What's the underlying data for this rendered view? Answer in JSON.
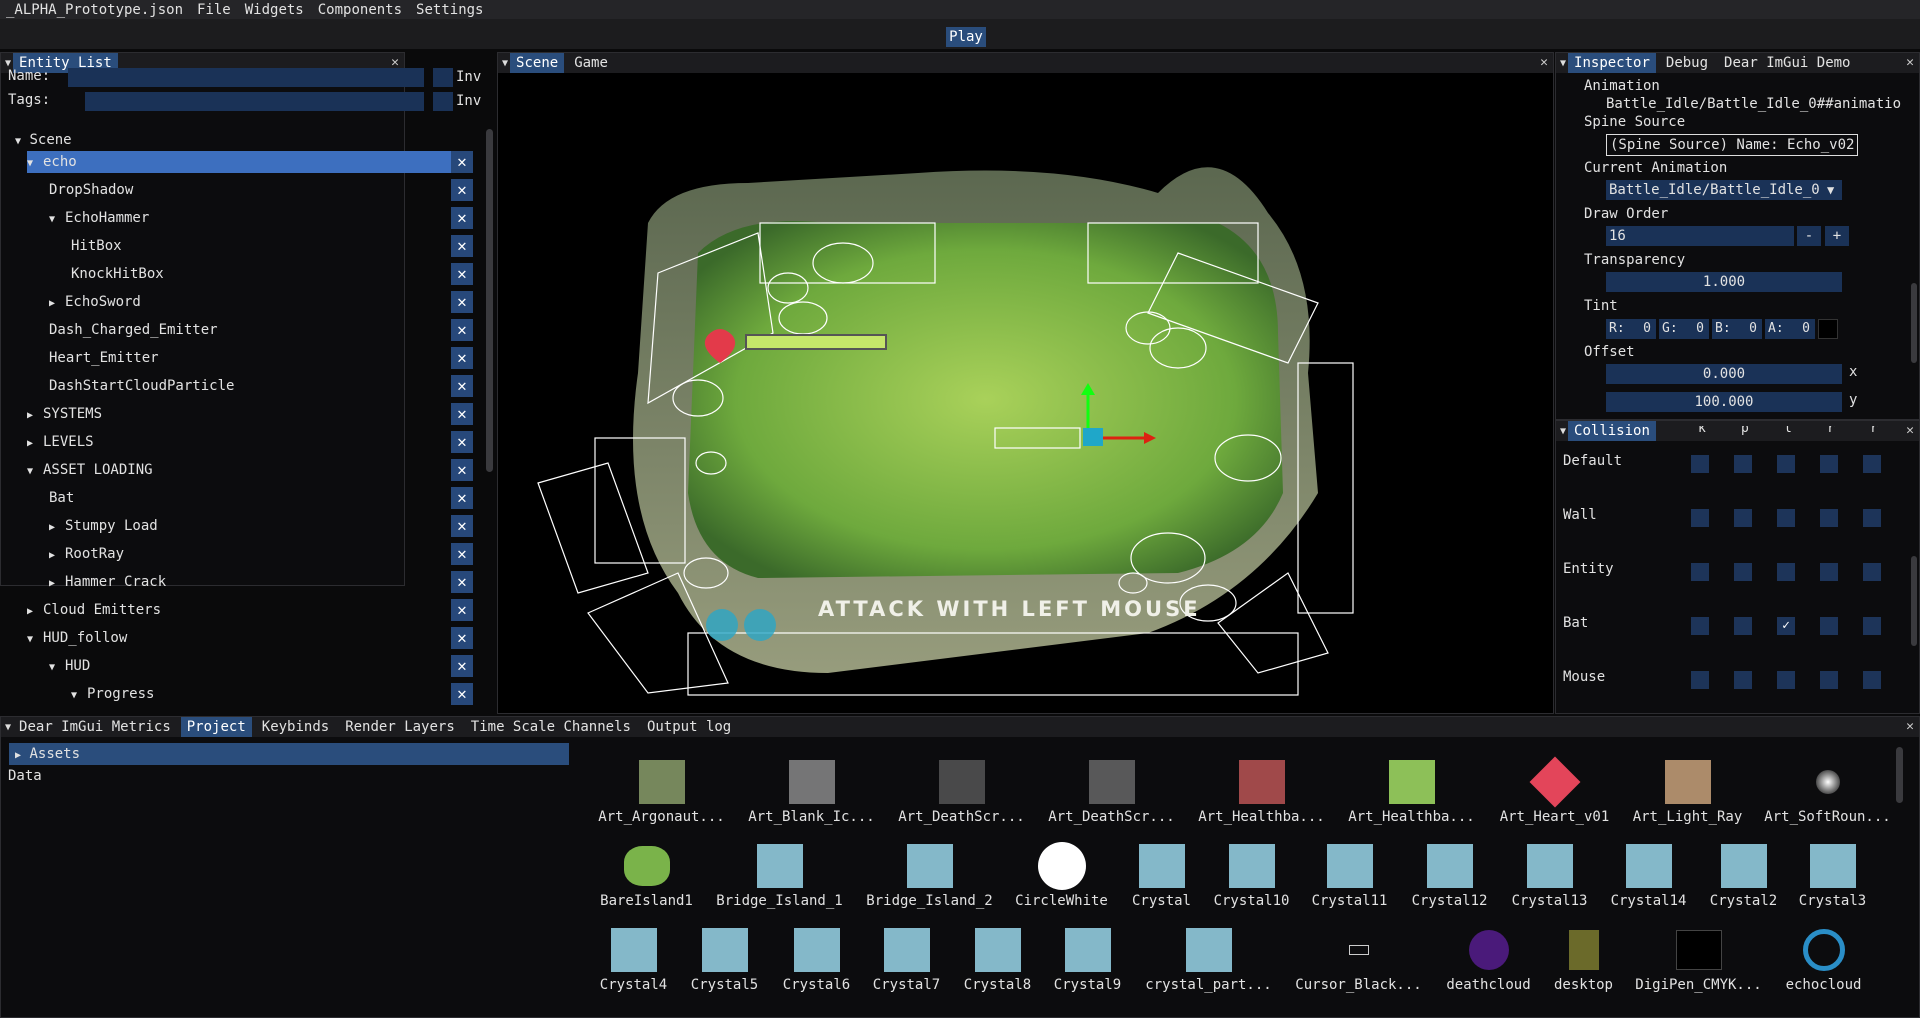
{
  "menu": {
    "file_title": "_ALPHA_Prototype.json",
    "items": [
      "File",
      "Widgets",
      "Components",
      "Settings"
    ]
  },
  "toolbar": {
    "play_label": "Play"
  },
  "entity_list": {
    "tab": "Entity List",
    "name_label": "Name:",
    "tags_label": "Tags:",
    "inv_label": "Inv",
    "scene_label": "Scene",
    "items": [
      {
        "label": "echo",
        "expanded": true,
        "indent": 1,
        "selected": true
      },
      {
        "label": "DropShadow",
        "indent": 2
      },
      {
        "label": "EchoHammer",
        "expanded": true,
        "indent": 2
      },
      {
        "label": "HitBox",
        "indent": 3
      },
      {
        "label": "KnockHitBox",
        "indent": 3
      },
      {
        "label": "EchoSword",
        "expanded": false,
        "indent": 2
      },
      {
        "label": "Dash_Charged_Emitter",
        "indent": 2
      },
      {
        "label": "Heart_Emitter",
        "indent": 2
      },
      {
        "label": "DashStartCloudParticle",
        "indent": 2
      },
      {
        "label": "SYSTEMS",
        "expanded": false,
        "indent": 1
      },
      {
        "label": "LEVELS",
        "expanded": false,
        "indent": 1
      },
      {
        "label": "ASSET LOADING",
        "expanded": true,
        "indent": 1
      },
      {
        "label": "Bat",
        "indent": 2
      },
      {
        "label": "Stumpy Load",
        "expanded": false,
        "indent": 2
      },
      {
        "label": "RootRay",
        "expanded": false,
        "indent": 2
      },
      {
        "label": "Hammer Crack",
        "expanded": false,
        "indent": 2
      },
      {
        "label": "Cloud Emitters",
        "expanded": false,
        "indent": 1
      },
      {
        "label": "HUD_follow",
        "expanded": true,
        "indent": 1
      },
      {
        "label": "HUD",
        "expanded": true,
        "indent": 2
      },
      {
        "label": "Progress",
        "expanded": true,
        "indent": 3
      }
    ]
  },
  "viewport": {
    "tabs": [
      "Scene",
      "Game"
    ],
    "hud_text": "ATTACK WITH LEFT MOUSE"
  },
  "inspector": {
    "tabs": [
      "Inspector",
      "Debug",
      "Dear ImGui Demo"
    ],
    "animation_label": "Animation",
    "animation_value": "Battle_Idle/Battle_Idle_0##animatio",
    "spine_source_label": "Spine Source",
    "spine_source_value": "(Spine Source) Name: Echo_v02",
    "current_animation_label": "Current Animation",
    "current_animation_value": "Battle_Idle/Battle_Idle_0",
    "draw_order_label": "Draw Order",
    "draw_order_value": "16",
    "minus": "-",
    "plus": "+",
    "transparency_label": "Transparency",
    "transparency_value": "1.000",
    "tint_label": "Tint",
    "tint": [
      {
        "ch": "R:",
        "v": "0"
      },
      {
        "ch": "G:",
        "v": "0"
      },
      {
        "ch": "B:",
        "v": "0"
      },
      {
        "ch": "A:",
        "v": "0"
      }
    ],
    "offset_label": "Offset",
    "offset_x": "0.000",
    "offset_x_axis": "x",
    "offset_y": "100.000",
    "offset_y_axis": "y"
  },
  "collision": {
    "tab": "Collision",
    "headers": [
      "k",
      "p",
      "l",
      "r",
      "r"
    ],
    "rows": [
      {
        "label": "Default",
        "checks": [
          false,
          false,
          false,
          false,
          false
        ]
      },
      {
        "label": "Wall",
        "checks": [
          false,
          false,
          false,
          false,
          false
        ]
      },
      {
        "label": "Entity",
        "checks": [
          false,
          false,
          false,
          false,
          false
        ]
      },
      {
        "label": "Bat",
        "checks": [
          false,
          false,
          true,
          false,
          false
        ]
      },
      {
        "label": "Mouse",
        "checks": [
          false,
          false,
          false,
          false,
          false
        ]
      }
    ]
  },
  "bottom": {
    "tabs": [
      "Dear ImGui Metrics",
      "Project",
      "Keybinds",
      "Render Layers",
      "Time Scale Channels",
      "Output log"
    ],
    "active_tab": "Project",
    "tree": [
      "Assets",
      "Data"
    ],
    "assets_row1": [
      "Art_Argonaut...",
      "Art_Blank_Ic...",
      "Art_DeathScr...",
      "Art_DeathScr...",
      "Art_Healthba...",
      "Art_Healthba...",
      "Art_Heart_v01",
      "Art_Light_Ray",
      "Art_SoftRoun..."
    ],
    "assets_row2": [
      "BareIsland1",
      "Bridge_Island_1",
      "Bridge_Island_2",
      "CircleWhite",
      "Crystal",
      "Crystal10",
      "Crystal11",
      "Crystal12",
      "Crystal13",
      "Crystal14",
      "Crystal2",
      "Crystal3"
    ],
    "assets_row3": [
      "Crystal4",
      "Crystal5",
      "Crystal6",
      "Crystal7",
      "Crystal8",
      "Crystal9",
      "crystal_part...",
      "Cursor_Black...",
      "deathcloud",
      "desktop",
      "DigiPen_CMYK...",
      "echocloud"
    ]
  },
  "colors": {
    "accent": "#2a4d7c",
    "select": "#3d6fbf",
    "field": "#1a3257",
    "panel": "#0c0c0e"
  }
}
